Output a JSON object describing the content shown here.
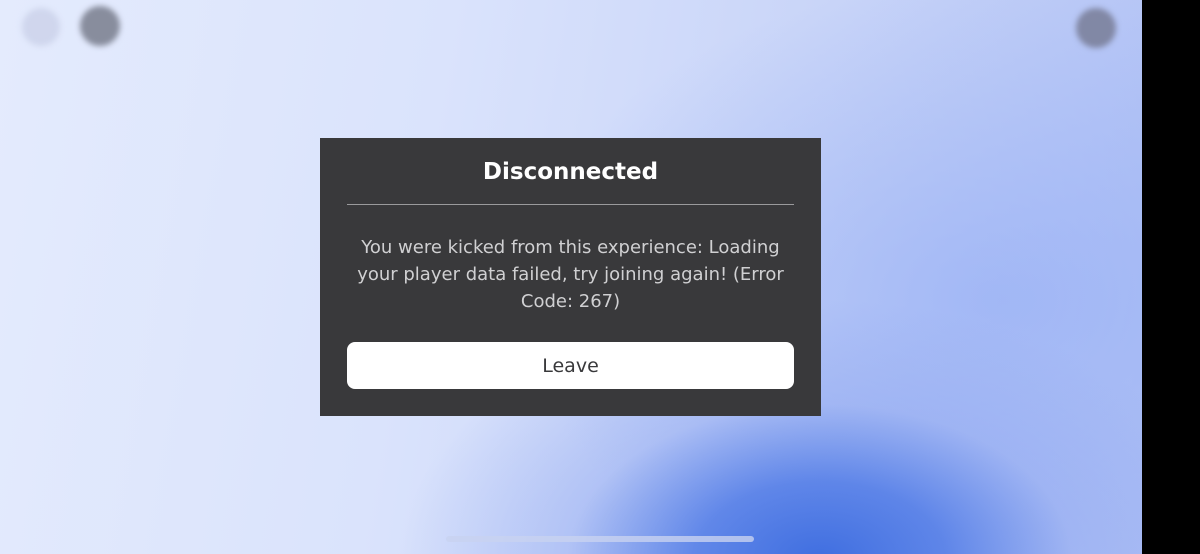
{
  "dialog": {
    "title": "Disconnected",
    "message": "You were kicked from this experience: Loading your player data failed, try joining again! (Error Code: 267)",
    "leave_label": "Leave"
  },
  "top_bar": {
    "left_icons": [
      "roblox-menu-icon",
      "chat-icon"
    ],
    "right_icons": [
      "more-options-icon"
    ]
  },
  "colors": {
    "dialog_background": "#39393b",
    "button_background": "#ffffff",
    "title_text": "#ffffff",
    "message_text": "#d0d0d2"
  }
}
